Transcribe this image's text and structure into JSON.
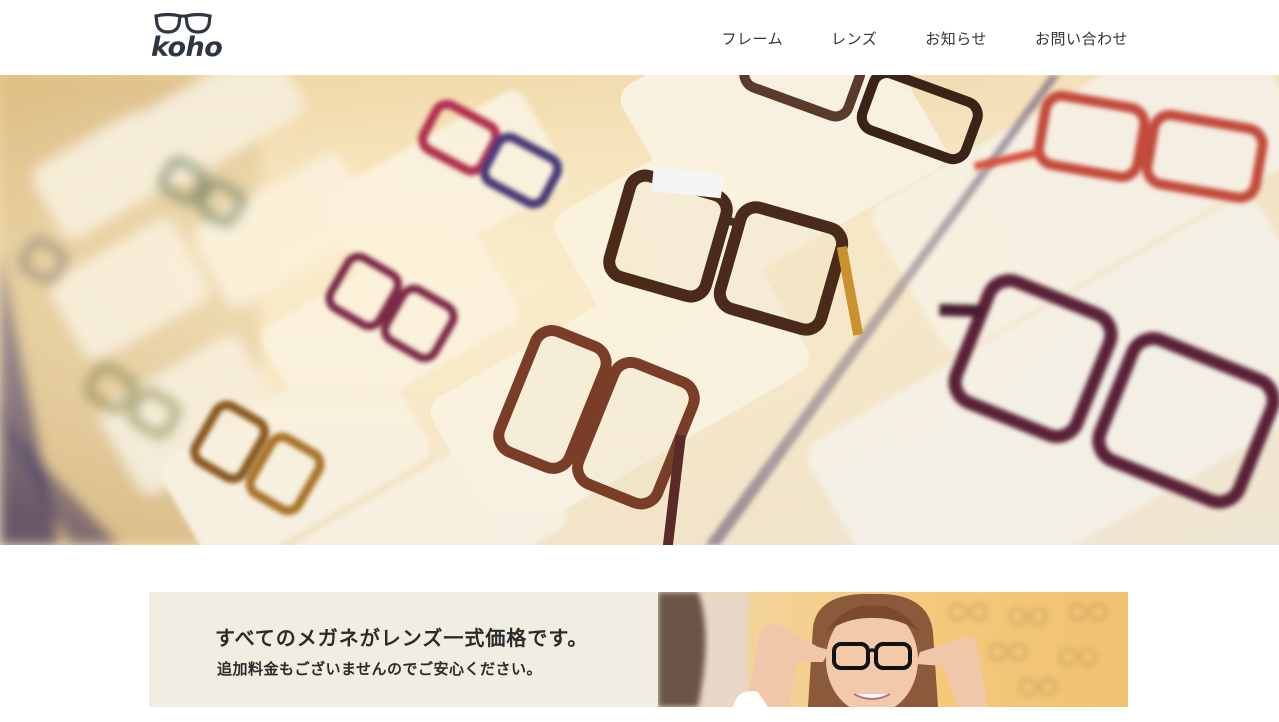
{
  "brand": {
    "name": "koho",
    "logo_icon": "glasses-icon"
  },
  "nav": {
    "items": [
      {
        "label": "フレーム"
      },
      {
        "label": "レンズ"
      },
      {
        "label": "お知らせ"
      },
      {
        "label": "お問い合わせ"
      }
    ]
  },
  "hero": {
    "image": "eyeglasses-display-photo"
  },
  "banner": {
    "title": "すべてのメガネがレンズ一式価格です。",
    "subtitle": "追加料金もございませんのでご安心ください。",
    "image": "woman-trying-glasses-photo"
  },
  "colors": {
    "header_bg": "#ffffff",
    "text": "#333333",
    "logo": "#2e3640",
    "banner_bg": "#f0ede3"
  }
}
